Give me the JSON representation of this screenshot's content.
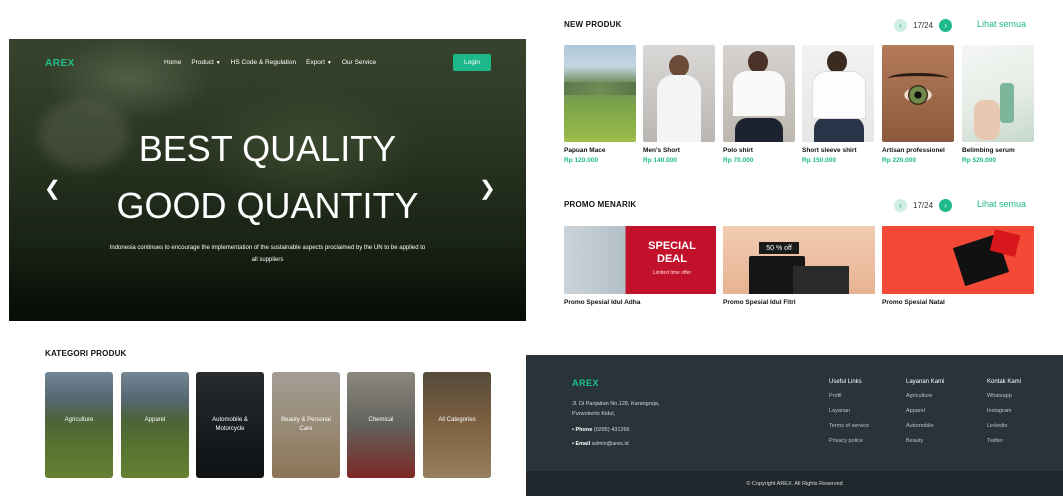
{
  "hero": {
    "logo": "AREX",
    "nav": [
      {
        "label": "Home",
        "dropdown": false
      },
      {
        "label": "Product",
        "dropdown": true
      },
      {
        "label": "HS Code & Regulation",
        "dropdown": false
      },
      {
        "label": "Export",
        "dropdown": true
      },
      {
        "label": "Our Service",
        "dropdown": false
      }
    ],
    "login_label": "Login",
    "title_line1": "BEST QUALITY",
    "title_line2": "GOOD QUANTITY",
    "subtitle": "Indonesia continues to encourage the implementation of the sustainable aspects proclaimed by the UN to be applied to all suppliers",
    "prev_icon": "chevron-left-icon",
    "next_icon": "chevron-right-icon"
  },
  "new_products": {
    "title": "NEW PRODUK",
    "page": "17/24",
    "see_all": "Lihat semua",
    "items": [
      {
        "name": "Papuan Mace",
        "price": "Rp 120.000"
      },
      {
        "name": "Men's Short",
        "price": "Rp 140.000"
      },
      {
        "name": "Polo shirt",
        "price": "Rp 70.000"
      },
      {
        "name": "Short sleeve shirt",
        "price": "Rp 150.000"
      },
      {
        "name": "Artisan professionel",
        "price": "Rp 220.000"
      },
      {
        "name": "Belimbing serum",
        "price": "Rp 520.000"
      }
    ]
  },
  "promo": {
    "title": "PROMO MENARIK",
    "page": "17/24",
    "see_all": "Lihat semua",
    "items": [
      {
        "name": "Promo Spesial Idul Adha",
        "banner_line1": "SPECIAL",
        "banner_line2": "DEAL",
        "banner_small": "Limited time offer"
      },
      {
        "name": "Promo Spesial Idul Fitri",
        "banner_tag": "50 % off"
      },
      {
        "name": "Promo Spesial Natal"
      }
    ]
  },
  "categories": {
    "title": "KATEGORI PRODUK",
    "items": [
      {
        "label": "Agriculture"
      },
      {
        "label": "Apparel"
      },
      {
        "label": "Automobile & Motorcycle"
      },
      {
        "label": "Beauty & Personal Care"
      },
      {
        "label": "Chemical"
      },
      {
        "label": "All Categories"
      }
    ]
  },
  "footer": {
    "logo": "AREX",
    "address": "Jl. Di Panjaitan No.128, Karangreja, Purwokerto Kidul,",
    "phone_label": "• Phone",
    "phone": "(0285) 431266",
    "email_label": "• Email",
    "email": "admin@arex.id",
    "columns": [
      {
        "heading": "Useful Links",
        "links": [
          "Profil",
          "Layanan",
          "Terms of service",
          "Privacy police"
        ]
      },
      {
        "heading": "Layanan Kami",
        "links": [
          "Agriculture",
          "Apparel",
          "Automobile",
          "Beauty"
        ]
      },
      {
        "heading": "Kontak Kami",
        "links": [
          "Whatsapp",
          "Instagram",
          "Linkedin",
          "Twitter"
        ]
      }
    ],
    "copyright": "© Copyright AREX. All Rights Reserved"
  },
  "colors": {
    "accent": "#1db98a",
    "footer_bg": "#29343a",
    "footer_bottom": "#1f272c"
  }
}
